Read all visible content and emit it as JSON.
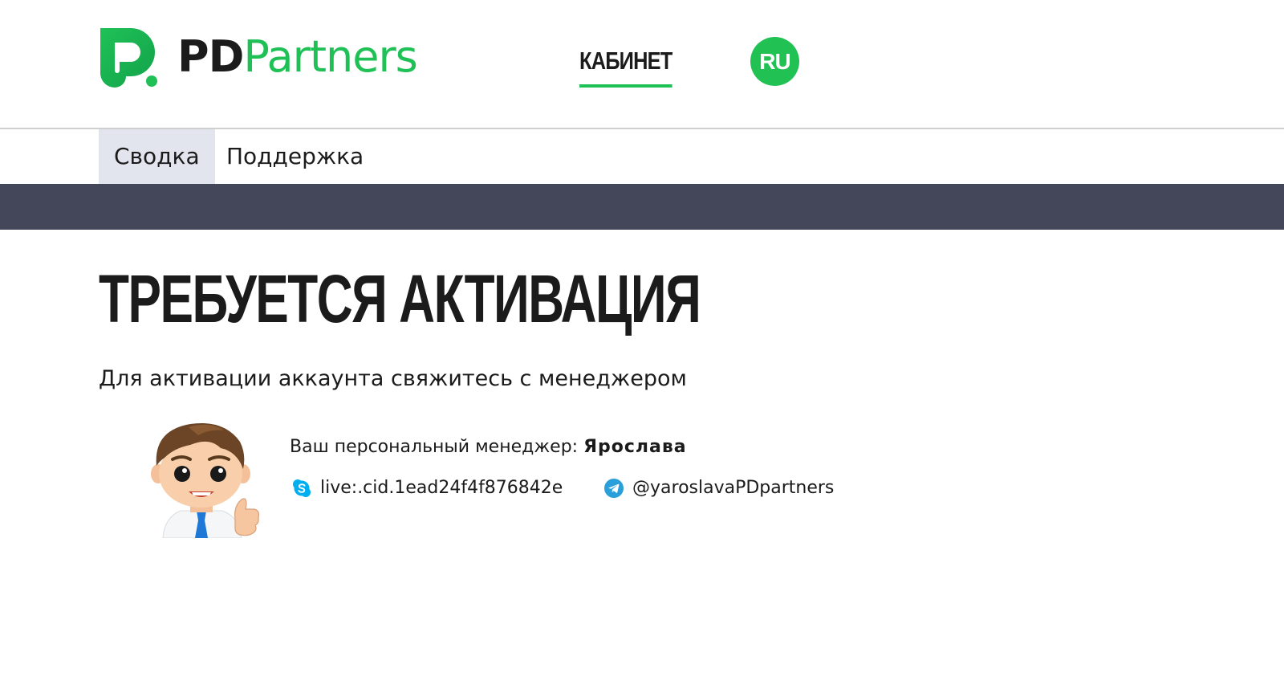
{
  "header": {
    "logo": {
      "text_bold": "PD",
      "text_light": "Partners"
    },
    "nav": {
      "cabinet_label": "КАБИНЕТ"
    },
    "language": {
      "current": "RU"
    }
  },
  "subnav": {
    "items": [
      {
        "label": "Сводка",
        "active": true
      },
      {
        "label": "Поддержка",
        "active": false
      }
    ]
  },
  "main": {
    "title": "ТРЕБУЕТСЯ АКТИВАЦИЯ",
    "subtitle": "Для активации аккаунта свяжитесь с менеджером",
    "manager": {
      "label": "Ваш персональный менеджер:",
      "name": "Ярослава",
      "skype": "live:.cid.1ead24f4f876842e",
      "telegram": "@yaroslavaPDpartners"
    }
  },
  "colors": {
    "brand_green": "#1fc157",
    "dark_band": "#444659",
    "active_tab_bg": "#e2e5ee",
    "skype_blue": "#00aff0",
    "telegram_blue": "#2a9fd9"
  },
  "icons": [
    "pd-logo-icon",
    "skype-icon",
    "telegram-icon",
    "manager-avatar"
  ]
}
